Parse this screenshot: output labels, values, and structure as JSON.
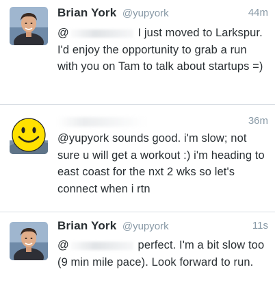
{
  "tweets": [
    {
      "author_name": "Brian York",
      "author_handle": "@yupyork",
      "timestamp": "44m",
      "text_prefix": "@",
      "text_body": " I just moved to Larkspur. I'd enjoy the opportunity to grab a run with you on Tam to talk about startups =)",
      "avatar": "profile-photo"
    },
    {
      "author_name": "",
      "author_handle": "",
      "timestamp": "36m",
      "text_body": "@yupyork sounds good.  i'm slow; not sure u will get a workout :)  i'm heading to east coast for the nxt 2 wks so let's connect when i rtn",
      "avatar": "smiley-face-icon"
    },
    {
      "author_name": "Brian York",
      "author_handle": "@yupyork",
      "timestamp": "11s",
      "text_prefix": "@",
      "text_body": " perfect. I'm a bit slow too (9 min mile pace). Look forward to run.",
      "avatar": "profile-photo"
    }
  ],
  "colors": {
    "text": "#292f33",
    "muted": "#8899a6",
    "divider": "#d8dde3",
    "smiley": "#ffe100"
  }
}
